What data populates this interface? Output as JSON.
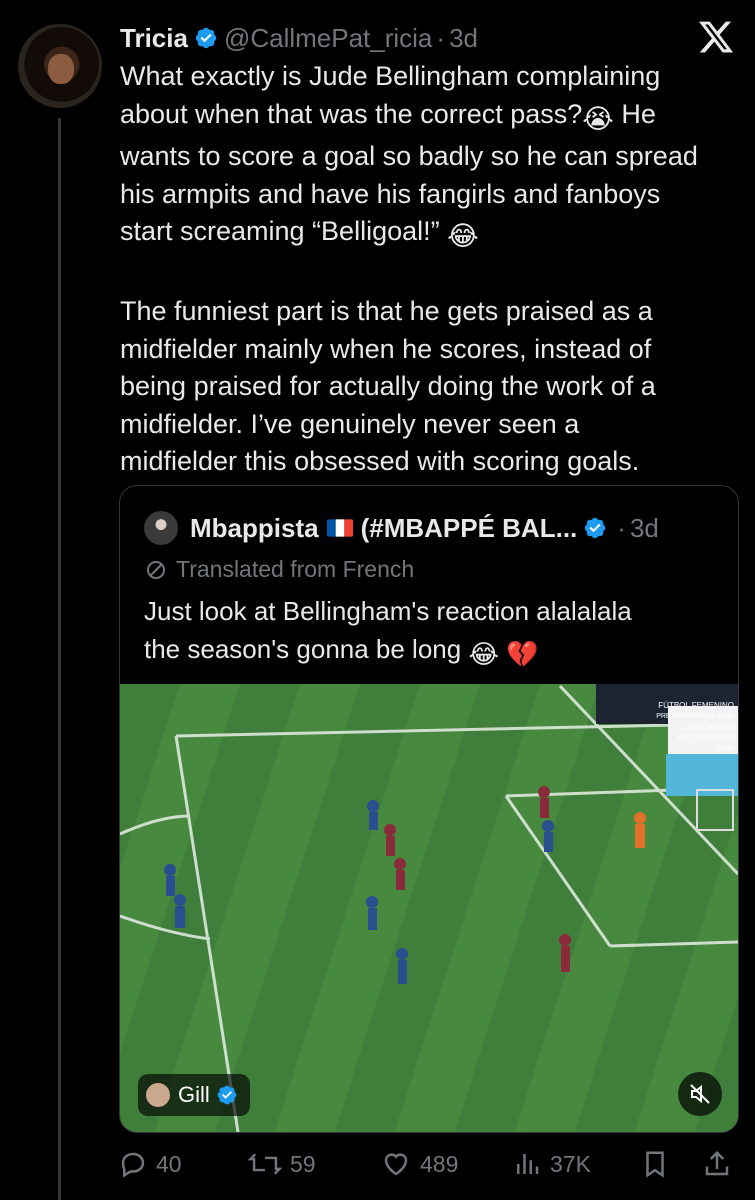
{
  "tweet": {
    "author_name": "Tricia",
    "handle": "@CallmePat_ricia",
    "separator": "·",
    "time": "3d",
    "text_line1": "What exactly is Jude Bellingham complaining",
    "text_line2": "about when that was the correct pass?",
    "text_line2b": " He",
    "text_line3": "wants to score a goal so badly so he can spread",
    "text_line4": "his armpits and have his fangirls and fanboys",
    "text_line5": "start screaming “Belligoal!”",
    "text_para2": "The funniest part is that he gets praised as a\nmidfielder mainly when he scores, instead of\nbeing praised for actually doing the work of a\nmidfielder. I’ve genuinely never seen a\nmidfielder this obsessed with scoring goals.",
    "emoji1": "😭",
    "emoji2": "😂"
  },
  "quoted": {
    "author_name": "Mbappista",
    "display_suffix": "(#MBAPPÉ BAL...",
    "separator": "·",
    "time": "3d",
    "translated_label": "Translated from French",
    "text": "Just look at Bellingham's reaction alalalala\nthe season's gonna be long ",
    "emoji1": "😂",
    "emoji2": "💔"
  },
  "video": {
    "tag_user": "Gill",
    "scoreboard": [
      "FÚTBOL FEMENINO",
      "PRETEMPORADA 24/25",
      "REAL MADRID",
      "R.C. DEPORTIVO",
      "20:00"
    ]
  },
  "actions": {
    "replies": "40",
    "reposts": "59",
    "likes": "489",
    "views": "37K"
  },
  "colors": {
    "background": "#000000",
    "text": "#e7e9ea",
    "muted": "#71767b",
    "verified": "#1d9bf0",
    "pitch": "#3d7a3a"
  },
  "icons": [
    "x-logo-icon",
    "verified-badge-icon",
    "translate-icon",
    "reply-icon",
    "repost-icon",
    "like-icon",
    "views-icon",
    "bookmark-icon",
    "share-icon",
    "mute-icon"
  ]
}
